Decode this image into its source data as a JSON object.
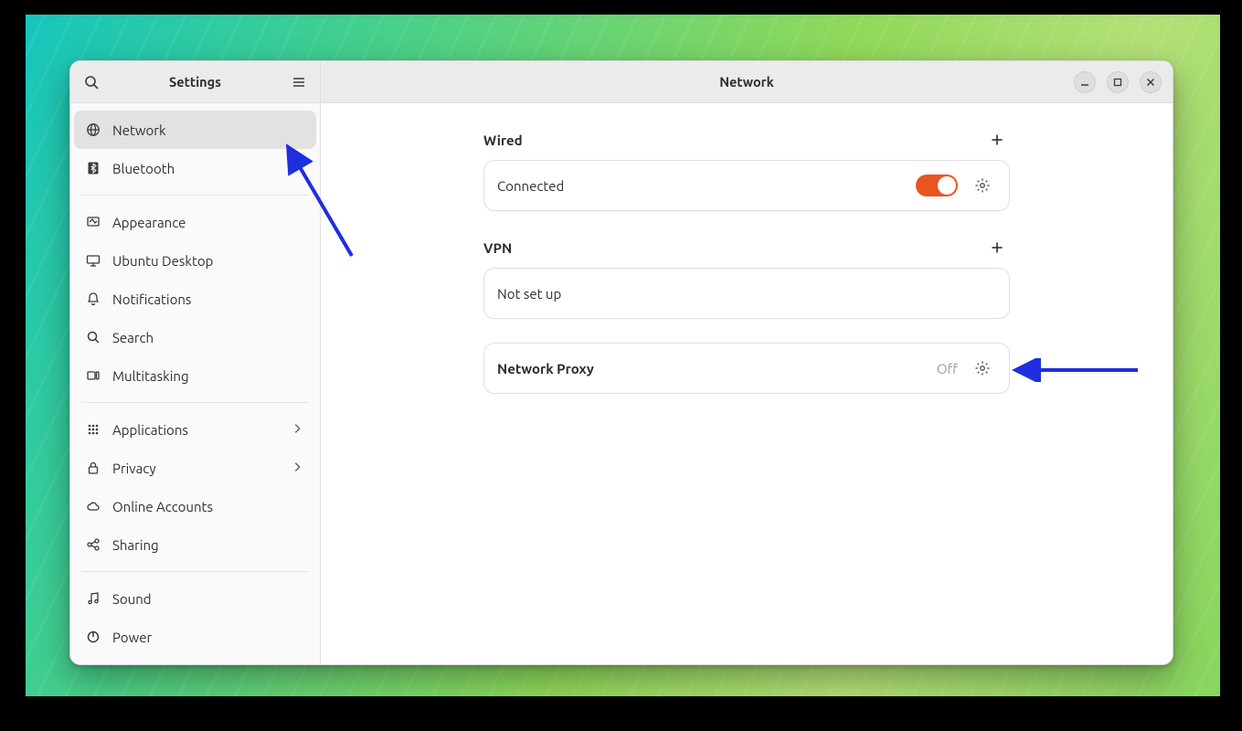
{
  "sidebar": {
    "title": "Settings",
    "groups": [
      [
        {
          "key": "network",
          "icon": "globe-icon",
          "label": "Network",
          "selected": true
        },
        {
          "key": "bluetooth",
          "icon": "bluetooth-icon",
          "label": "Bluetooth"
        }
      ],
      [
        {
          "key": "appearance",
          "icon": "appearance-icon",
          "label": "Appearance"
        },
        {
          "key": "ubuntu-desktop",
          "icon": "desktop-icon",
          "label": "Ubuntu Desktop"
        },
        {
          "key": "notifications",
          "icon": "bell-icon",
          "label": "Notifications"
        },
        {
          "key": "search",
          "icon": "search-icon",
          "label": "Search"
        },
        {
          "key": "multitasking",
          "icon": "multitasking-icon",
          "label": "Multitasking"
        }
      ],
      [
        {
          "key": "applications",
          "icon": "grid-icon",
          "label": "Applications",
          "submenu": true
        },
        {
          "key": "privacy",
          "icon": "lock-icon",
          "label": "Privacy",
          "submenu": true
        },
        {
          "key": "online-accounts",
          "icon": "cloud-icon",
          "label": "Online Accounts"
        },
        {
          "key": "sharing",
          "icon": "share-icon",
          "label": "Sharing"
        }
      ],
      [
        {
          "key": "sound",
          "icon": "music-icon",
          "label": "Sound"
        },
        {
          "key": "power",
          "icon": "power-icon",
          "label": "Power"
        }
      ]
    ]
  },
  "main": {
    "title": "Network",
    "wired": {
      "section_label": "Wired",
      "status": "Connected",
      "toggle_on": true
    },
    "vpn": {
      "section_label": "VPN",
      "status": "Not set up"
    },
    "proxy": {
      "label": "Network Proxy",
      "status": "Off"
    }
  },
  "colors": {
    "accent": "#e95420"
  }
}
